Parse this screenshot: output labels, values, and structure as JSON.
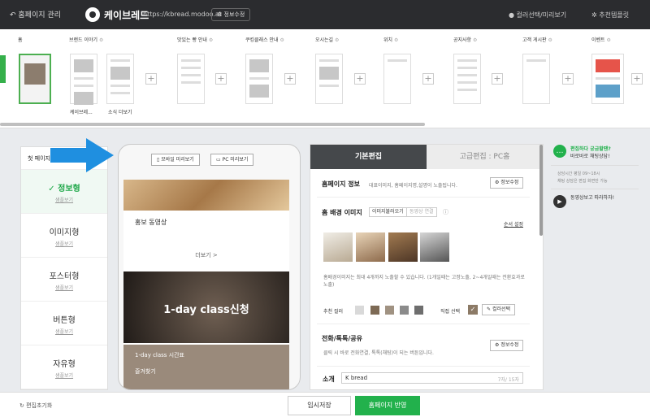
{
  "topbar": {
    "back_label": "홈페이지 관리",
    "site_name": "케이브레드",
    "site_url": "https://kbread.modoo.at",
    "edit_info": "정보수정",
    "color_preview": "컬러선택/미리보기",
    "recommend_template": "추천템플릿"
  },
  "sections": [
    {
      "label": "홈"
    },
    {
      "label": "브랜드 이야기"
    },
    {
      "label": "맛있는 빵 안내"
    },
    {
      "label": "쿠킹클래스 안내"
    },
    {
      "label": "오시는길"
    },
    {
      "label": "위치"
    },
    {
      "label": "공지사항"
    },
    {
      "label": "고객 게시판"
    },
    {
      "label": "이벤트"
    }
  ],
  "subpages": {
    "brand_sub_1": "케이브레...",
    "brand_sub_2": "소식 더보기"
  },
  "left_panel": {
    "header": "첫 페이지",
    "items": [
      {
        "title": "정보형",
        "sub": "샘플보기"
      },
      {
        "title": "이미지형",
        "sub": "샘플보기"
      },
      {
        "title": "포스터형",
        "sub": "샘플보기"
      },
      {
        "title": "버튼형",
        "sub": "샘플보기"
      },
      {
        "title": "자유형",
        "sub": "샘플보기"
      }
    ]
  },
  "preview": {
    "mobile_btn": "모바일 미리보기",
    "pc_btn": "PC 미리보기",
    "video_label": "홍보 동영상",
    "more_label": "더보기 >",
    "class_banner": "1-day class신청",
    "class_time": "1-day class 시간표",
    "shortcut": "즐겨찾기"
  },
  "right_panel": {
    "tabs": [
      "기본편집",
      "고급편집 : PC홈"
    ],
    "homepage_info_title": "홈페이지 정보",
    "homepage_info_desc": "대표이미지, 홈페이지명,설명이 노출됩니다.",
    "edit_btn": "정보수정",
    "bg_image_title": "홈 배경 이미지",
    "image_btn": "이미지불러오기",
    "video_btn": "동영상 연결",
    "order_setting": "순서 설정",
    "bg_note": "홈배경이미지는 최대 4개까지 노출할 수 있습니다. (1개일때는 고정노출, 2~4개일때는 전환효과로 노출)",
    "recommend_color": "추천 컬러",
    "direct_select": "직접 선택",
    "color_select_btn": "컬러선택",
    "phone_title": "전화/톡톡/공유",
    "phone_desc": "클릭 시 바로 전화연결, 톡톡(채팅)이 되는 버튼입니다.",
    "intro_label": "소개",
    "intro_value": "K bread",
    "intro_count": "7자/ 15자"
  },
  "side_help": {
    "chat_title": "편집하다 궁금할땐?",
    "chat_sub": "바로바로 채팅상담!",
    "hours": "상담시간 평일 09~18시",
    "hours_note": "채팅 상담은 편집 화면만 가능",
    "video_help": "동영상보고 따라하자!"
  },
  "bottom": {
    "reset": "편집초기화",
    "temp_save": "임시저장",
    "publish": "홈페이지 반영"
  },
  "colors": {
    "accent": "#22b14c",
    "topbar": "#2b2c2f",
    "swatches": [
      "#d9d9d9",
      "#7d6a55",
      "#a09282",
      "#8b8b8b",
      "#6e6e6e"
    ]
  }
}
